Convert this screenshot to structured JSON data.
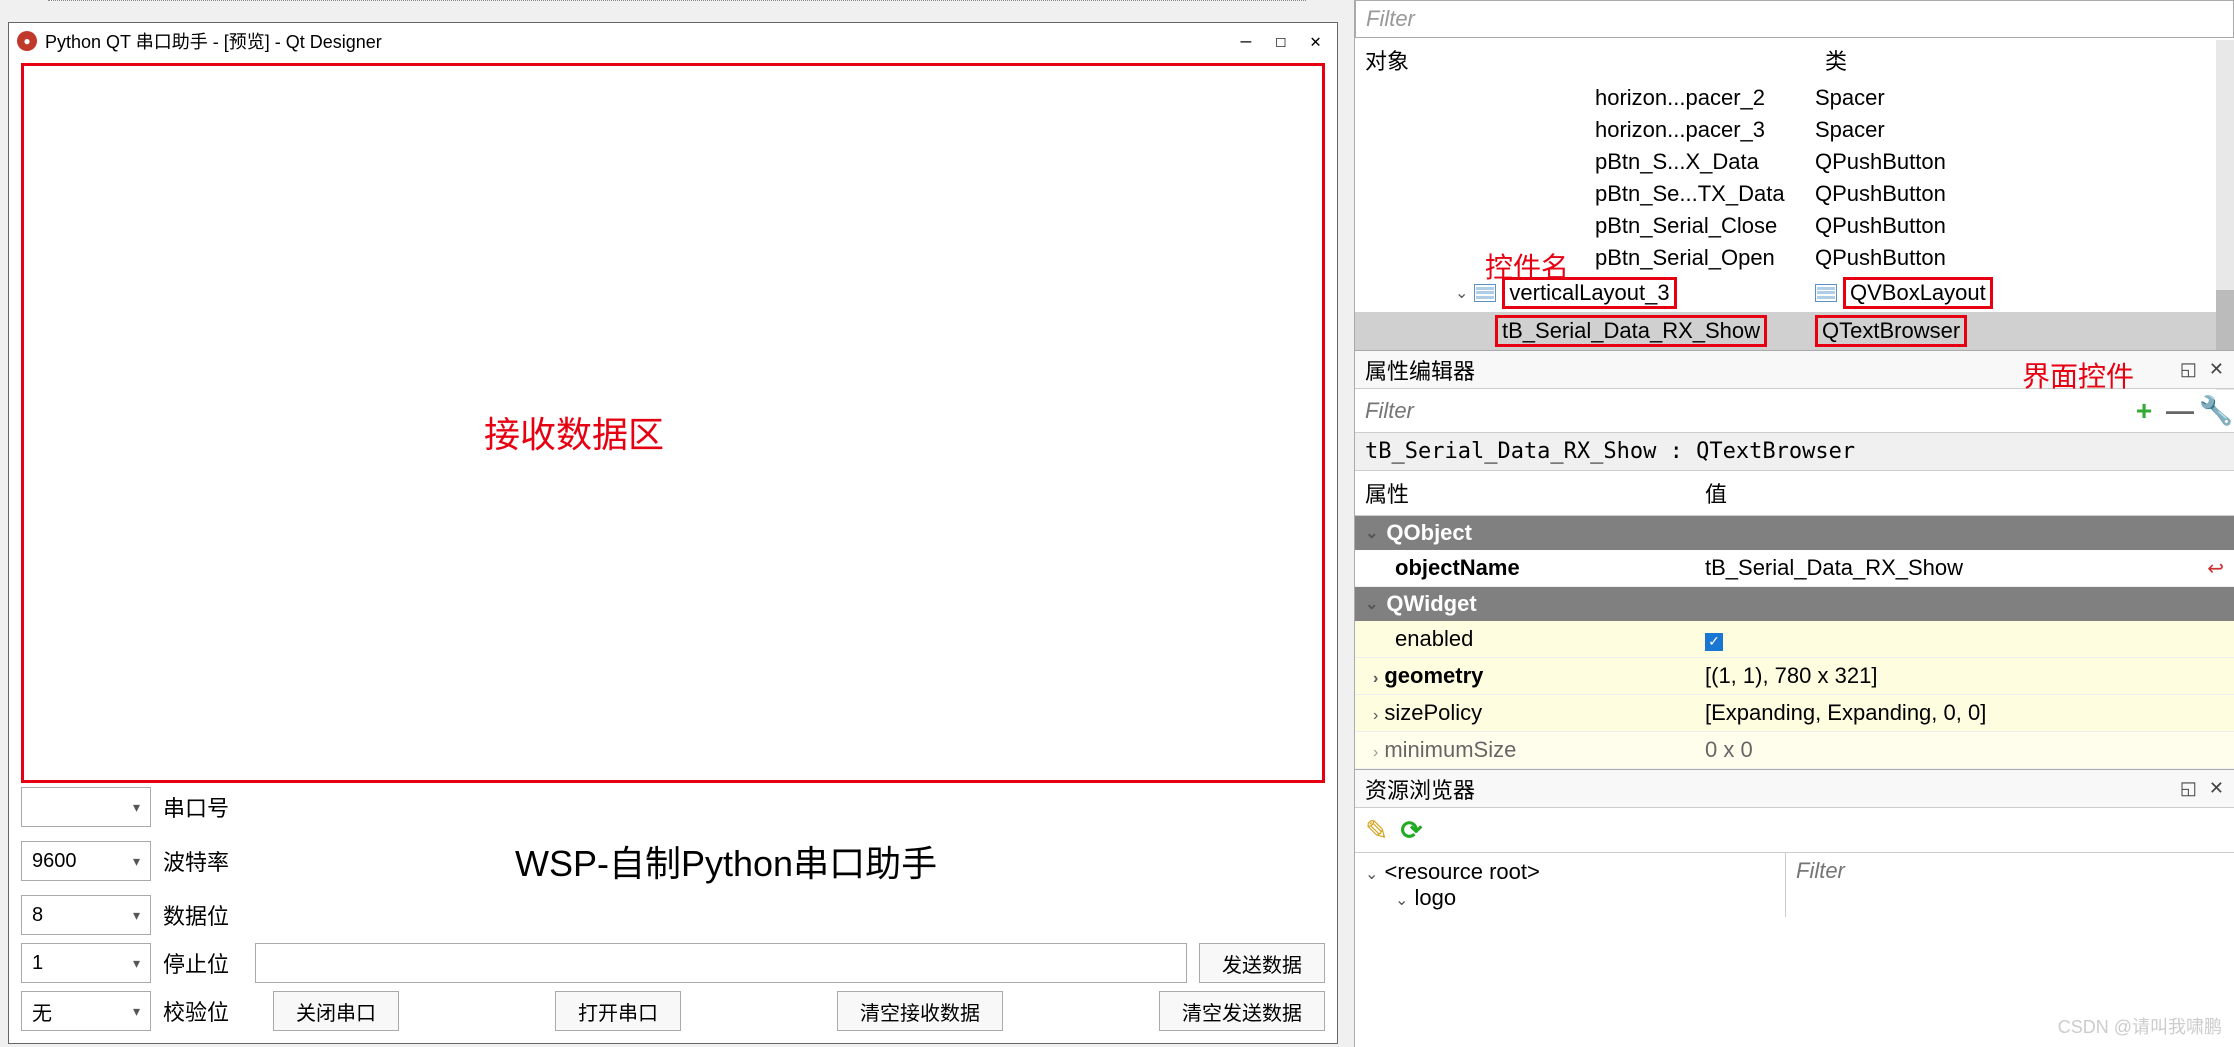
{
  "preview": {
    "title": "Python QT 串口助手 - [预览] - Qt Designer",
    "rx_area_annotation": "接收数据区",
    "settings": {
      "port_label": "串口号",
      "baud_label": "波特率",
      "baud_value": "9600",
      "databits_label": "数据位",
      "databits_value": "8",
      "stopbits_label": "停止位",
      "stopbits_value": "1",
      "parity_label": "校验位",
      "parity_value": "无"
    },
    "app_title": "WSP-自制Python串口助手",
    "buttons": {
      "send": "发送数据",
      "close_port": "关闭串口",
      "open_port": "打开串口",
      "clear_rx": "清空接收数据",
      "clear_tx": "清空发送数据"
    }
  },
  "inspector": {
    "filter_placeholder": "Filter",
    "col_object": "对象",
    "col_class": "类",
    "rows": [
      {
        "obj": "horizon...pacer_2",
        "cls": "Spacer"
      },
      {
        "obj": "horizon...pacer_3",
        "cls": "Spacer"
      },
      {
        "obj": "pBtn_S...X_Data",
        "cls": "QPushButton"
      },
      {
        "obj": "pBtn_Se...TX_Data",
        "cls": "QPushButton"
      },
      {
        "obj": "pBtn_Serial_Close",
        "cls": "QPushButton"
      },
      {
        "obj": "pBtn_Serial_Open",
        "cls": "QPushButton"
      }
    ],
    "layout_row": {
      "obj": "verticalLayout_3",
      "cls": "QVBoxLayout"
    },
    "selected_row": {
      "obj": "tB_Serial_Data_RX_Show",
      "cls": "QTextBrowser"
    },
    "anno_widget_name": "控件名",
    "anno_ui_widget": "界面控件"
  },
  "prop": {
    "panel_title": "属性编辑器",
    "filter_placeholder": "Filter",
    "selected_text": "tB_Serial_Data_RX_Show : QTextBrowser",
    "col_prop": "属性",
    "col_value": "值",
    "group_qobject": "QObject",
    "objectName_label": "objectName",
    "objectName_value": "tB_Serial_Data_RX_Show",
    "group_qwidget": "QWidget",
    "enabled_label": "enabled",
    "geometry_label": "geometry",
    "geometry_value": "[(1, 1), 780 x 321]",
    "sizePolicy_label": "sizePolicy",
    "sizePolicy_value": "[Expanding, Expanding, 0, 0]",
    "minimumSize_label": "minimumSize",
    "minimumSize_value": "0 x 0"
  },
  "res": {
    "panel_title": "资源浏览器",
    "filter_placeholder": "Filter",
    "root": "<resource root>",
    "child": "logo"
  },
  "watermark": "CSDN @请叫我啸鹏"
}
